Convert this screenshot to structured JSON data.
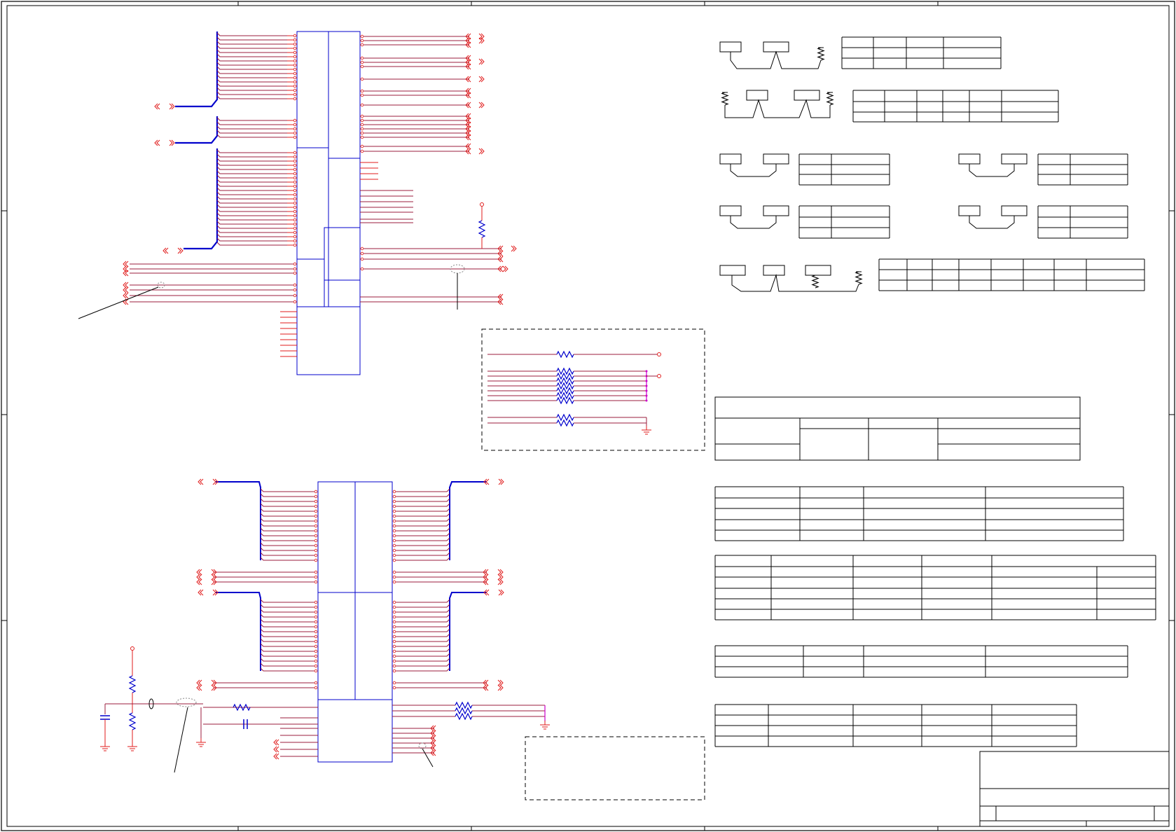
{
  "sheet": {
    "title_text": "",
    "zone_markers": [
      "",
      "",
      "",
      ""
    ]
  },
  "colors": {
    "frame": "#000000",
    "wire": "#9b1c3c",
    "pin": "#e01b1b",
    "bus": "#0000cc",
    "component_box": "#0000cc",
    "power": "#e01b1b",
    "net_pin": "#cc00cc",
    "dashed": "#000000",
    "table_line": "#000000"
  },
  "icons": {
    "offpage_connector": "double-chevron-connector-icon",
    "resistor": "resistor-icon",
    "capacitor": "capacitor-icon",
    "ground": "ground-icon",
    "power_rail": "power-pin-icon"
  },
  "components": {
    "upper_connector": {
      "label": ""
    },
    "lower_connector": {
      "label": ""
    }
  },
  "notes": {
    "upper_dashed_box": "",
    "lower_dashed_box": ""
  }
}
